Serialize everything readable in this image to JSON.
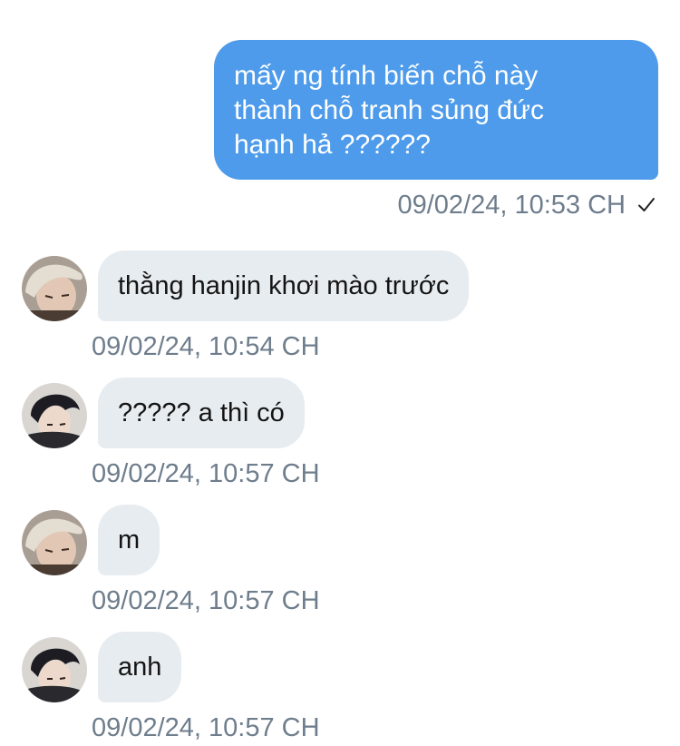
{
  "outgoing": {
    "lines": [
      "mấy ng tính biến chỗ này",
      "thành chỗ tranh sủng đức",
      "hạnh hả ??????"
    ],
    "timestamp": "09/02/24, 10:53 CH",
    "status_icon": "check-icon"
  },
  "incoming": [
    {
      "text": "thằng hanjin khơi mào trước",
      "timestamp": "09/02/24, 10:54 CH",
      "avatar": "avatar-light-hair"
    },
    {
      "text": "????? a thì có",
      "timestamp": "09/02/24, 10:57 CH",
      "avatar": "avatar-dark-hair"
    },
    {
      "text": "m",
      "timestamp": "09/02/24, 10:57 CH",
      "avatar": "avatar-light-hair"
    },
    {
      "text": "anh",
      "timestamp": "09/02/24, 10:57 CH",
      "avatar": "avatar-dark-hair"
    }
  ],
  "colors": {
    "outgoing_bubble": "#4d9bea",
    "incoming_bubble": "#e7ecf0",
    "meta_text": "#6e7d8c"
  }
}
